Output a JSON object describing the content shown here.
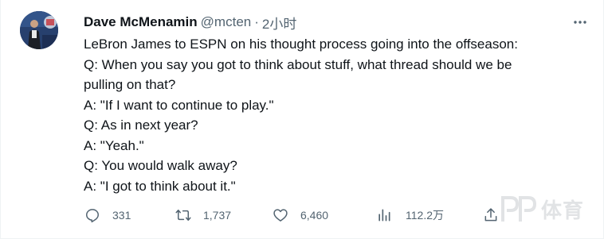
{
  "author": {
    "display_name": "Dave McMenamin",
    "handle": "@mcten",
    "separator": "·",
    "time": "2小时",
    "avatar_icon": "avatar-icon"
  },
  "more_icon": "more-icon",
  "tweet": {
    "lines": [
      "LeBron James to ESPN on his thought process going into the offseason:",
      "Q: When you say you got to think about stuff, what thread should we be",
      "pulling on that?",
      "A: \"If I want to continue to play.\"",
      "Q: As in next year?",
      "A: \"Yeah.\"",
      "Q: You would walk away?",
      "A: \"I got to think about it.\""
    ]
  },
  "actions": {
    "reply": {
      "count": "331",
      "icon": "reply-icon"
    },
    "retweet": {
      "count": "1,737",
      "icon": "retweet-icon"
    },
    "like": {
      "count": "6,460",
      "icon": "like-icon"
    },
    "views": {
      "count": "112.2万",
      "icon": "views-icon"
    },
    "share": {
      "icon": "share-icon"
    }
  },
  "watermark": {
    "text": "体育",
    "icon": "pp-logo-icon"
  },
  "colors": {
    "text_primary": "#0f1419",
    "text_secondary": "#536471",
    "background": "#ffffff"
  }
}
